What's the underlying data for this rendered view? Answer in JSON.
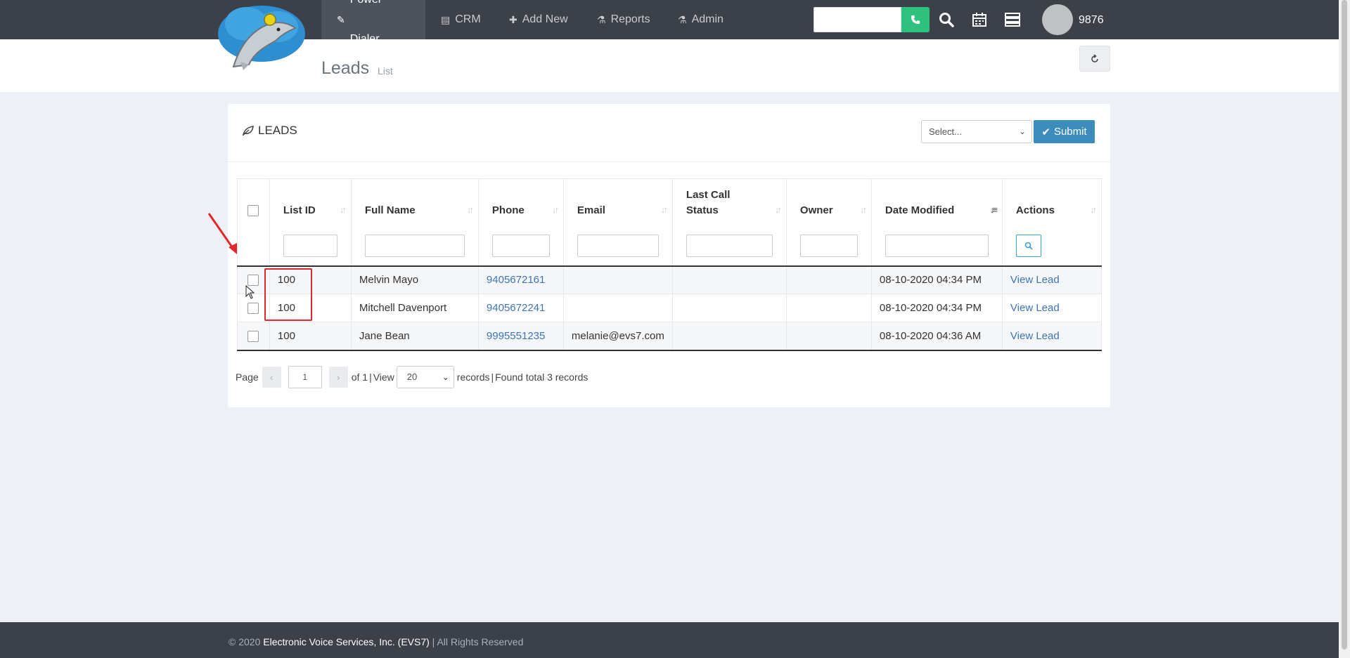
{
  "nav": {
    "items": [
      {
        "label": "Power Dialer",
        "icon": "pencil-icon",
        "active": true
      },
      {
        "label": "CRM",
        "icon": "book-icon"
      },
      {
        "label": "Add New",
        "icon": "plus-icon"
      },
      {
        "label": "Reports",
        "icon": "flask-icon"
      },
      {
        "label": "Admin",
        "icon": "flask-icon"
      }
    ],
    "dial_placeholder": "",
    "extension": "9876"
  },
  "header": {
    "title": "Leads",
    "subtitle": "List"
  },
  "panel": {
    "title": "LEADS",
    "bulk_select": "Select...",
    "submit_label": "Submit"
  },
  "table": {
    "columns": [
      "List ID",
      "Full Name",
      "Phone",
      "Email",
      "Last Call Status",
      "Owner",
      "Date Modified",
      "Actions"
    ],
    "rows": [
      {
        "list_id": "100",
        "full_name": "Melvin Mayo",
        "phone": "9405672161",
        "email": "",
        "last_call_status": "",
        "owner": "",
        "date_modified": "08-10-2020 04:34 PM",
        "action": "View Lead"
      },
      {
        "list_id": "100",
        "full_name": "Mitchell Davenport",
        "phone": "9405672241",
        "email": "",
        "last_call_status": "",
        "owner": "",
        "date_modified": "08-10-2020 04:34 PM",
        "action": "View Lead"
      },
      {
        "list_id": "100",
        "full_name": "Jane Bean",
        "phone": "9995551235",
        "email": "melanie@evs7.com",
        "last_call_status": "",
        "owner": "",
        "date_modified": "08-10-2020 04:36 AM",
        "action": "View Lead"
      }
    ]
  },
  "pager": {
    "page_label": "Page",
    "prev": "‹",
    "page_value": "1",
    "next": "›",
    "of_text": "of 1",
    "view_label": "View",
    "per_page": "20",
    "records_label": "records",
    "found_text": "Found total 3 records"
  },
  "footer": {
    "prefix": "© 2020 ",
    "company": "Electronic Voice Services, Inc. (EVS7)",
    "suffix": " | All Rights Reserved"
  },
  "colors": {
    "topbar": "#3b4049",
    "accent": "#3c8dbc",
    "call": "#2ec27e",
    "highlight": "#e0272c",
    "link": "#3c74b8"
  }
}
